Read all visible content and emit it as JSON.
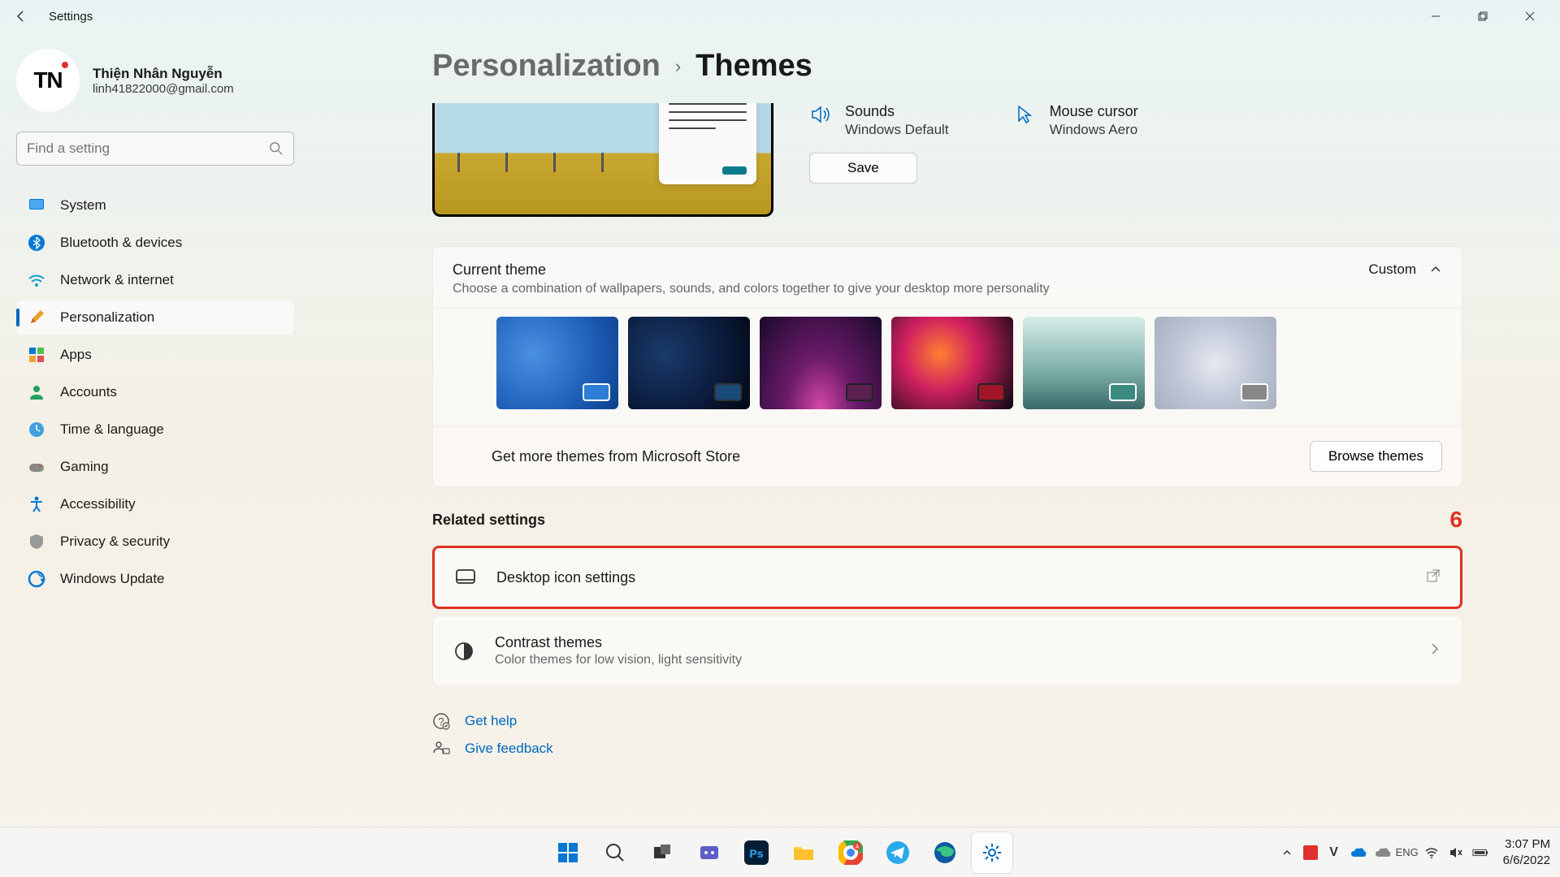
{
  "window": {
    "title": "Settings"
  },
  "profile": {
    "name": "Thiện Nhân Nguyễn",
    "email": "linh41822000@gmail.com",
    "avatar_text": "TN"
  },
  "search": {
    "placeholder": "Find a setting"
  },
  "nav": {
    "items": [
      {
        "label": "System"
      },
      {
        "label": "Bluetooth & devices"
      },
      {
        "label": "Network & internet"
      },
      {
        "label": "Personalization"
      },
      {
        "label": "Apps"
      },
      {
        "label": "Accounts"
      },
      {
        "label": "Time & language"
      },
      {
        "label": "Gaming"
      },
      {
        "label": "Accessibility"
      },
      {
        "label": "Privacy & security"
      },
      {
        "label": "Windows Update"
      }
    ],
    "active_index": 3
  },
  "breadcrumb": {
    "parent": "Personalization",
    "current": "Themes"
  },
  "theme_opts": {
    "sounds": {
      "title": "Sounds",
      "value": "Windows Default"
    },
    "cursor": {
      "title": "Mouse cursor",
      "value": "Windows Aero"
    },
    "save_label": "Save"
  },
  "current_theme": {
    "title": "Current theme",
    "desc": "Choose a combination of wallpapers, sounds, and colors together to give your desktop more personality",
    "selected": "Custom",
    "store_text": "Get more themes from Microsoft Store",
    "browse_label": "Browse themes"
  },
  "related": {
    "header": "Related settings",
    "annotation": "6",
    "items": [
      {
        "title": "Desktop icon settings",
        "desc": ""
      },
      {
        "title": "Contrast themes",
        "desc": "Color themes for low vision, light sensitivity"
      }
    ]
  },
  "help": {
    "get_help": "Get help",
    "give_feedback": "Give feedback"
  },
  "taskbar": {
    "time": "3:07 PM",
    "date": "6/6/2022"
  }
}
